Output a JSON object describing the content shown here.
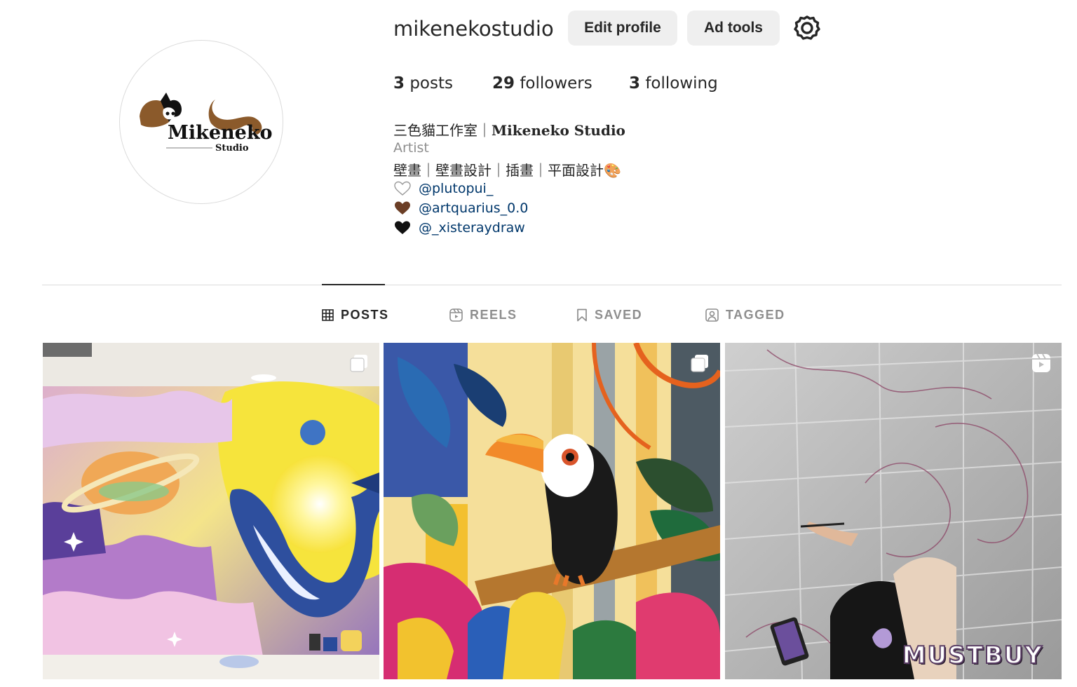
{
  "profile": {
    "username": "mikenekostudio",
    "avatar_text": "Mikeneko",
    "avatar_subtext": "Studio"
  },
  "actions": {
    "edit_profile": "Edit profile",
    "ad_tools": "Ad tools",
    "settings_icon": "gear-icon"
  },
  "stats": {
    "posts_count": "3",
    "posts_label": "posts",
    "followers_count": "29",
    "followers_label": "followers",
    "following_count": "3",
    "following_label": "following"
  },
  "bio": {
    "title_prefix": "三色貓工作室｜",
    "title_name": "Mikeneko Studio",
    "category": "Artist",
    "description": "壁畫｜壁畫設計｜插畫｜平面設計🎨",
    "links": [
      {
        "heart_color": "#ffffff",
        "handle": "@plutopui_"
      },
      {
        "heart_color": "#6b3e26",
        "handle": "@artquarius_0.0"
      },
      {
        "heart_color": "#111111",
        "handle": "@_xisteraydraw"
      }
    ]
  },
  "tabs": [
    {
      "label": "POSTS",
      "icon": "grid-icon",
      "active": true
    },
    {
      "label": "REELS",
      "icon": "reels-icon",
      "active": false
    },
    {
      "label": "SAVED",
      "icon": "bookmark-icon",
      "active": false
    },
    {
      "label": "TAGGED",
      "icon": "tagged-icon",
      "active": false
    }
  ],
  "posts": [
    {
      "subject": "whale space mural",
      "type_icon": "carousel-icon"
    },
    {
      "subject": "toucan jungle mural",
      "type_icon": "carousel-icon"
    },
    {
      "subject": "artist sketching on wall",
      "type_icon": "reel-icon"
    }
  ],
  "watermark": "MUSTBUY",
  "colors": {
    "text": "#262626",
    "muted": "#8e8e8e",
    "link": "#00376b",
    "button_bg": "#efefef",
    "divider": "#dbdbdb"
  }
}
